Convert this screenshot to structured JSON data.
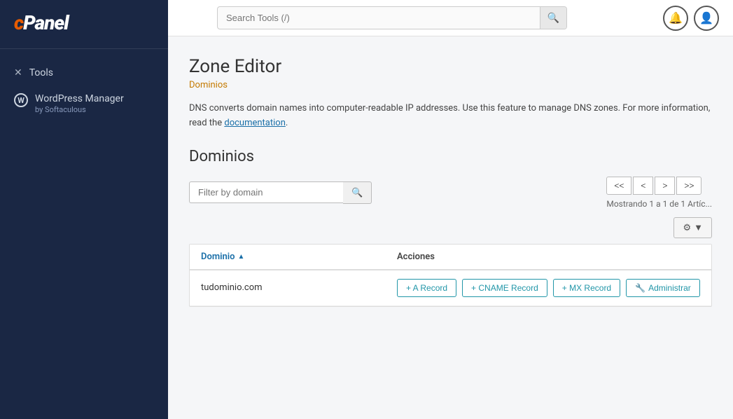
{
  "sidebar": {
    "logo": "cPanel",
    "logo_c": "c",
    "items": [
      {
        "id": "tools",
        "label": "Tools",
        "icon": "✕"
      },
      {
        "id": "wordpress-manager",
        "label": "WordPress Manager",
        "sublabel": "by Softaculous",
        "icon": "W"
      }
    ]
  },
  "topbar": {
    "search_placeholder": "Search Tools (/)",
    "search_icon": "🔍",
    "notifications_icon": "🔔",
    "user_icon": "👤"
  },
  "content": {
    "page_title": "Zone Editor",
    "breadcrumb": "Dominios",
    "description_text": "DNS converts domain names into computer-readable IP addresses. Use this feature to manage DNS zones. For more information, read the",
    "description_link": "documentation",
    "description_end": ".",
    "section_title": "Dominios",
    "filter_placeholder": "Filter by domain",
    "showing_text": "Mostrando 1 a 1 de 1 Artíc...",
    "pagination": {
      "first": "<<",
      "prev": "<",
      "next": ">",
      "last": ">>"
    },
    "table": {
      "col_domain": "Dominio",
      "col_actions": "Acciones",
      "rows": [
        {
          "domain": "tudominio.com",
          "actions": [
            {
              "id": "a-record",
              "label": "+ A Record"
            },
            {
              "id": "cname-record",
              "label": "+ CNAME Record"
            },
            {
              "id": "mx-record",
              "label": "+ MX Record"
            },
            {
              "id": "administrar",
              "label": "Administrar",
              "icon": "🔧"
            }
          ]
        }
      ]
    },
    "settings_btn": "⚙"
  }
}
